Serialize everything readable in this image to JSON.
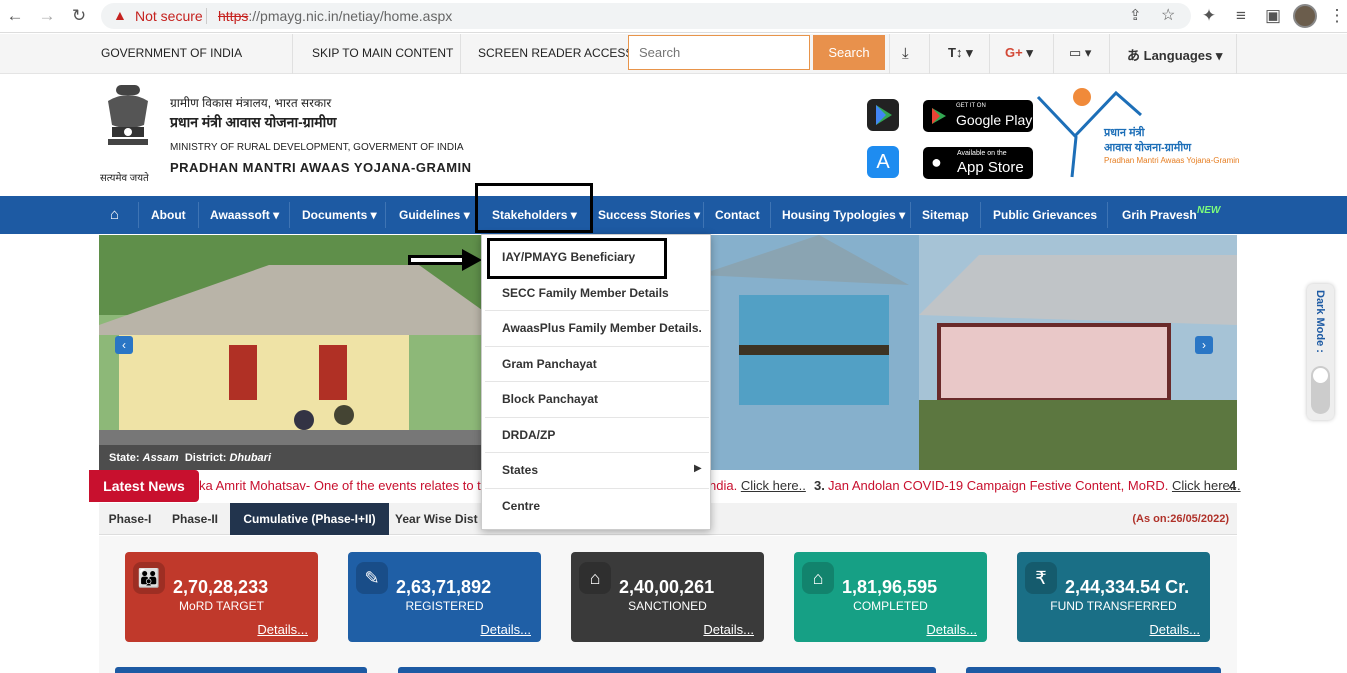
{
  "browser": {
    "not_secure": "Not secure",
    "url_scheme": "https",
    "url_rest": "://pmayg.nic.in/netiay/home.aspx"
  },
  "topbar": {
    "gov": "GOVERNMENT OF INDIA",
    "skip": "SKIP TO MAIN CONTENT",
    "reader": "SCREEN READER ACCESS",
    "search_placeholder": "Search",
    "search_button": "Search",
    "font_size": "T↕",
    "languages": "Languages"
  },
  "header": {
    "hindi_ministry": "ग्रामीण विकास मंत्रालय, भारत सरकार",
    "hindi_scheme": "प्रधान मंत्री आवास योजना-ग्रामीण",
    "ministry": "MINISTRY OF RURAL DEVELOPMENT, GOVERMENT OF INDIA",
    "scheme": "PRADHAN MANTRI AWAAS YOJANA-GRAMIN",
    "emblem_motto": "सत्यमेव जयते",
    "google_small": "GET IT ON",
    "google_big": "Google Play",
    "apple_small": "Available on the",
    "apple_big": "App Store",
    "logo_line1": "प्रधान मंत्री",
    "logo_line2": "आवास योजना-ग्रामीण",
    "logo_line3": "Pradhan Mantri Awaas Yojana-Gramin"
  },
  "nav": {
    "items": [
      "About",
      "Awaassoft",
      "Documents",
      "Guidelines",
      "Stakeholders",
      "Success Stories",
      "Contact",
      "Housing Typologies",
      "Sitemap",
      "Public Grievances",
      "Grih Pravesh"
    ],
    "new_badge": "NEW"
  },
  "dropdown": {
    "items": [
      "IAY/PMAYG Beneficiary",
      "SECC Family Member Details",
      "AwaasPlus Family Member Details.",
      "Gram Panchayat",
      "Block Panchayat",
      "DRDA/ZP",
      "States",
      "Centre"
    ]
  },
  "banner": {
    "state_label": "State:",
    "state": "Assam",
    "district_label": "District:",
    "district": "Dhubari"
  },
  "ticker": {
    "label": "Latest News",
    "text1": "ka Amrit Mohatsav- One of the events relates to th",
    "text2": "ndia.",
    "link1": "Click here..",
    "num3": "3.",
    "text3": "Jan Andolan COVID-19 Campaign Festive Content, MoRD.",
    "link3": "Click here...",
    "num4": "4"
  },
  "tabs": {
    "items": [
      "Phase-I",
      "Phase-II",
      "Cumulative (Phase-I+II)",
      "Year Wise Dist"
    ],
    "as_on": "(As on:26/05/2022)"
  },
  "cards": [
    {
      "value": "2,70,28,233",
      "label": "MoRD TARGET",
      "details": "Details...",
      "color": "#c0392b",
      "icon": "people-icon"
    },
    {
      "value": "2,63,71,892",
      "label": "REGISTERED",
      "details": "Details...",
      "color": "#1f5fa6",
      "icon": "register-icon"
    },
    {
      "value": "2,40,00,261",
      "label": "SANCTIONED",
      "details": "Details...",
      "color": "#3a3a3a",
      "icon": "house-icon"
    },
    {
      "value": "1,81,96,595",
      "label": "COMPLETED",
      "details": "Details...",
      "color": "#16a085",
      "icon": "completed-house-icon"
    },
    {
      "value": "2,44,334.54 Cr.",
      "label": "FUND TRANSFERRED",
      "details": "Details...",
      "color": "#1a6f86",
      "icon": "rupee-icon"
    }
  ],
  "dark_mode": "Dark Mode :"
}
